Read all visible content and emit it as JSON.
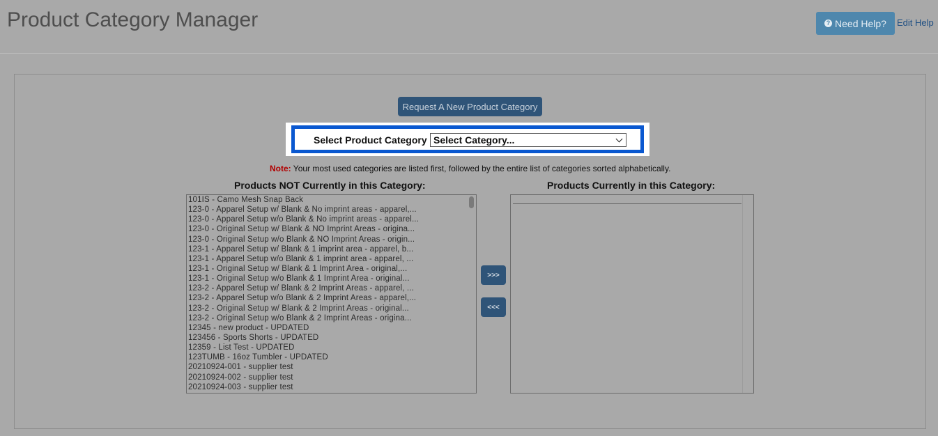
{
  "header": {
    "title": "Product Category Manager",
    "help_label": "Need Help?",
    "edit_help_label": "Edit Help"
  },
  "request_button_label": "Request A New Product Category",
  "category_select": {
    "label": "Select Product Category",
    "selected": "Select Category..."
  },
  "note": {
    "label": "Note:",
    "text": " Your most used categories are listed first, followed by the entire list of categories sorted alphabetically."
  },
  "left_list": {
    "heading": "Products NOT Currently in this Category:",
    "items": [
      "101IS - Camo Mesh Snap Back",
      "123-0 - Apparel Setup w/ Blank & No imprint areas - apparel,...",
      "123-0 - Apparel Setup w/o Blank & No imprint areas - apparel...",
      "123-0 - Original Setup w/ Blank & NO Imprint Areas - origina...",
      "123-0 - Original Setup w/o Blank & NO Imprint Areas - origin...",
      "123-1 - Apparel Setup w/ Blank & 1 imprint area - apparel, b...",
      "123-1 - Apparel Setup w/o Blank & 1 imprint area - apparel, ...",
      "123-1 - Original Setup w/ Blank & 1 Imprint Area - original,...",
      "123-1 - Original Setup w/o Blank & 1 Imprint Area - original...",
      "123-2 - Apparel Setup w/ Blank & 2 Imprint Areas - apparel, ...",
      "123-2 - Apparel Setup w/o Blank & 2 Imprint Areas - apparel,...",
      "123-2 - Original Setup w/ Blank & 2 Imprint Areas - original...",
      "123-2 - Original Setup w/o Blank & 2 Imprint Areas - origina...",
      "12345 - new product - UPDATED",
      "123456 - Sports Shorts - UPDATED",
      "12359 - List Test - UPDATED",
      "123TUMB - 16oz Tumbler - UPDATED",
      "20210924-001 - supplier test",
      "20210924-002 - supplier test",
      "20210924-003 - supplier test"
    ]
  },
  "right_list": {
    "heading": "Products Currently in this Category:"
  },
  "move_buttons": {
    "add_label": ">>>",
    "remove_label": "<<<"
  }
}
